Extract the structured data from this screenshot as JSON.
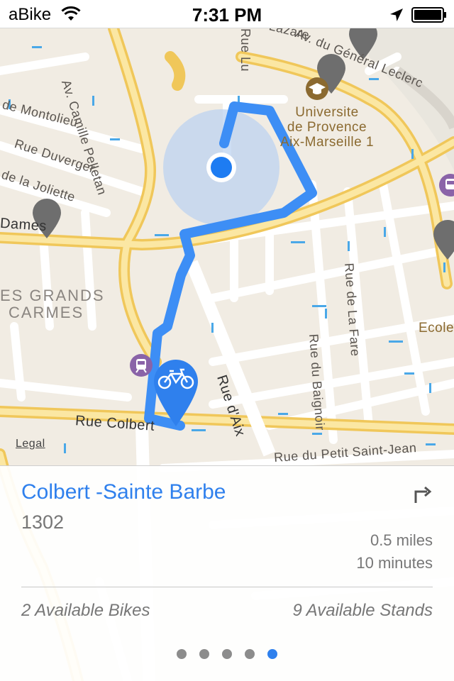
{
  "status_bar": {
    "carrier": "aBike",
    "time": "7:31 PM",
    "wifi_icon": "wifi-icon",
    "location_icon": "location-arrow-icon",
    "battery_icon": "battery-icon"
  },
  "map": {
    "streets": [
      "Rue Saint-Lazare",
      "Av. Camille Pelletan",
      "de Montolieu",
      "Rue Duverger",
      "de la Joliette",
      "Dames",
      "Rue Colbert",
      "Rue d'Aix",
      "Rue du Petit Saint-Jean",
      "Rue du Baignoir",
      "Rue de La Fare",
      "Av. du Général Leclerc",
      "Rue Lu"
    ],
    "district": [
      "ES GRANDS",
      "CARMES"
    ],
    "poi": [
      "Universite",
      "de Provence",
      "Aix-Marseille 1"
    ],
    "poi_right": "Ecole",
    "legal": "Legal",
    "route_color": "#3d8ef5",
    "user_location_color": "#1e7cf2",
    "station_pin_color": "#2f80ed",
    "station_pin_icon": "bicycle-icon",
    "other_pin_icon": "map-pin-icon",
    "poi_icon": "graduation-cap-icon",
    "transit_icon": "tram-icon"
  },
  "station": {
    "name": "Colbert -Sainte Barbe",
    "id": "1302",
    "distance": "0.5 miles",
    "duration": "10 minutes",
    "available_bikes": "2 Available Bikes",
    "available_stands": "9 Available Stands",
    "directions_icon": "turn-right-arrow-icon",
    "page_count": 5,
    "active_page": 5
  },
  "colors": {
    "accent": "#2f80ed",
    "secondary_text": "#777777"
  }
}
